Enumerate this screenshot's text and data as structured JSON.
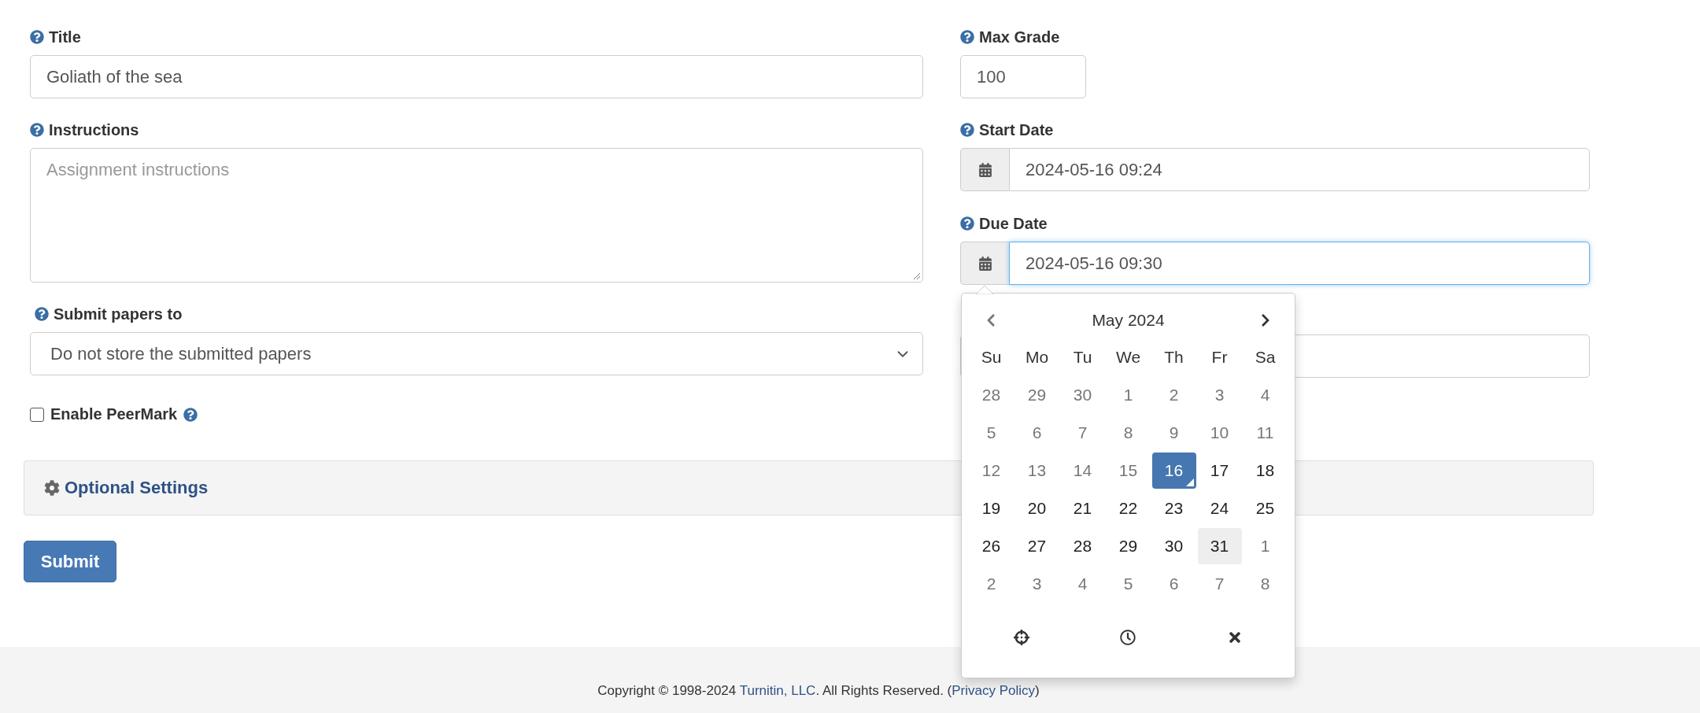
{
  "form": {
    "title": {
      "label": "Title",
      "value": "Goliath of the sea"
    },
    "instructions": {
      "label": "Instructions",
      "placeholder": "Assignment instructions"
    },
    "submit_papers": {
      "label": "Submit papers to",
      "value": "Do not store the submitted papers"
    },
    "peermark": {
      "label": "Enable PeerMark",
      "checked": false
    },
    "max_grade": {
      "label": "Max Grade",
      "value": "100"
    },
    "start_date": {
      "label": "Start Date",
      "value": "2024-05-16 09:24",
      "focused": false
    },
    "due_date": {
      "label": "Due Date",
      "value": "2024-05-16 09:30",
      "focused": true
    }
  },
  "date_picker": {
    "month": "May 2024",
    "weekdays": [
      "Su",
      "Mo",
      "Tu",
      "We",
      "Th",
      "Fr",
      "Sa"
    ],
    "days": [
      {
        "label": "28",
        "muted": true,
        "selected": false,
        "hovered": false,
        "today": false
      },
      {
        "label": "29",
        "muted": true,
        "selected": false,
        "hovered": false,
        "today": false
      },
      {
        "label": "30",
        "muted": true,
        "selected": false,
        "hovered": false,
        "today": false
      },
      {
        "label": "1",
        "muted": true,
        "selected": false,
        "hovered": false,
        "today": false
      },
      {
        "label": "2",
        "muted": true,
        "selected": false,
        "hovered": false,
        "today": false
      },
      {
        "label": "3",
        "muted": true,
        "selected": false,
        "hovered": false,
        "today": false
      },
      {
        "label": "4",
        "muted": true,
        "selected": false,
        "hovered": false,
        "today": false
      },
      {
        "label": "5",
        "muted": true,
        "selected": false,
        "hovered": false,
        "today": false
      },
      {
        "label": "6",
        "muted": true,
        "selected": false,
        "hovered": false,
        "today": false
      },
      {
        "label": "7",
        "muted": true,
        "selected": false,
        "hovered": false,
        "today": false
      },
      {
        "label": "8",
        "muted": true,
        "selected": false,
        "hovered": false,
        "today": false
      },
      {
        "label": "9",
        "muted": true,
        "selected": false,
        "hovered": false,
        "today": false
      },
      {
        "label": "10",
        "muted": true,
        "selected": false,
        "hovered": false,
        "today": false
      },
      {
        "label": "11",
        "muted": true,
        "selected": false,
        "hovered": false,
        "today": false
      },
      {
        "label": "12",
        "muted": true,
        "selected": false,
        "hovered": false,
        "today": false
      },
      {
        "label": "13",
        "muted": true,
        "selected": false,
        "hovered": false,
        "today": false
      },
      {
        "label": "14",
        "muted": true,
        "selected": false,
        "hovered": false,
        "today": false
      },
      {
        "label": "15",
        "muted": true,
        "selected": false,
        "hovered": false,
        "today": false
      },
      {
        "label": "16",
        "muted": false,
        "selected": true,
        "hovered": false,
        "today": true
      },
      {
        "label": "17",
        "muted": false,
        "selected": false,
        "hovered": false,
        "today": false
      },
      {
        "label": "18",
        "muted": false,
        "selected": false,
        "hovered": false,
        "today": false
      },
      {
        "label": "19",
        "muted": false,
        "selected": false,
        "hovered": false,
        "today": false
      },
      {
        "label": "20",
        "muted": false,
        "selected": false,
        "hovered": false,
        "today": false
      },
      {
        "label": "21",
        "muted": false,
        "selected": false,
        "hovered": false,
        "today": false
      },
      {
        "label": "22",
        "muted": false,
        "selected": false,
        "hovered": false,
        "today": false
      },
      {
        "label": "23",
        "muted": false,
        "selected": false,
        "hovered": false,
        "today": false
      },
      {
        "label": "24",
        "muted": false,
        "selected": false,
        "hovered": false,
        "today": false
      },
      {
        "label": "25",
        "muted": false,
        "selected": false,
        "hovered": false,
        "today": false
      },
      {
        "label": "26",
        "muted": false,
        "selected": false,
        "hovered": false,
        "today": false
      },
      {
        "label": "27",
        "muted": false,
        "selected": false,
        "hovered": false,
        "today": false
      },
      {
        "label": "28",
        "muted": false,
        "selected": false,
        "hovered": false,
        "today": false
      },
      {
        "label": "29",
        "muted": false,
        "selected": false,
        "hovered": false,
        "today": false
      },
      {
        "label": "30",
        "muted": false,
        "selected": false,
        "hovered": false,
        "today": false
      },
      {
        "label": "31",
        "muted": false,
        "selected": false,
        "hovered": true,
        "today": false
      },
      {
        "label": "1",
        "muted": true,
        "selected": false,
        "hovered": false,
        "today": false
      },
      {
        "label": "2",
        "muted": true,
        "selected": false,
        "hovered": false,
        "today": false
      },
      {
        "label": "3",
        "muted": true,
        "selected": false,
        "hovered": false,
        "today": false
      },
      {
        "label": "4",
        "muted": true,
        "selected": false,
        "hovered": false,
        "today": false
      },
      {
        "label": "5",
        "muted": true,
        "selected": false,
        "hovered": false,
        "today": false
      },
      {
        "label": "6",
        "muted": true,
        "selected": false,
        "hovered": false,
        "today": false
      },
      {
        "label": "7",
        "muted": true,
        "selected": false,
        "hovered": false,
        "today": false
      },
      {
        "label": "8",
        "muted": true,
        "selected": false,
        "hovered": false,
        "today": false
      }
    ]
  },
  "optional_settings": {
    "label": "Optional Settings"
  },
  "submit_button": "Submit",
  "footer": {
    "copyright": "Copyright © 1998-2024 ",
    "company_link": "Turnitin, LLC",
    "rights": ". All Rights Reserved. (",
    "privacy_link": "Privacy Policy",
    "closing": ")"
  }
}
